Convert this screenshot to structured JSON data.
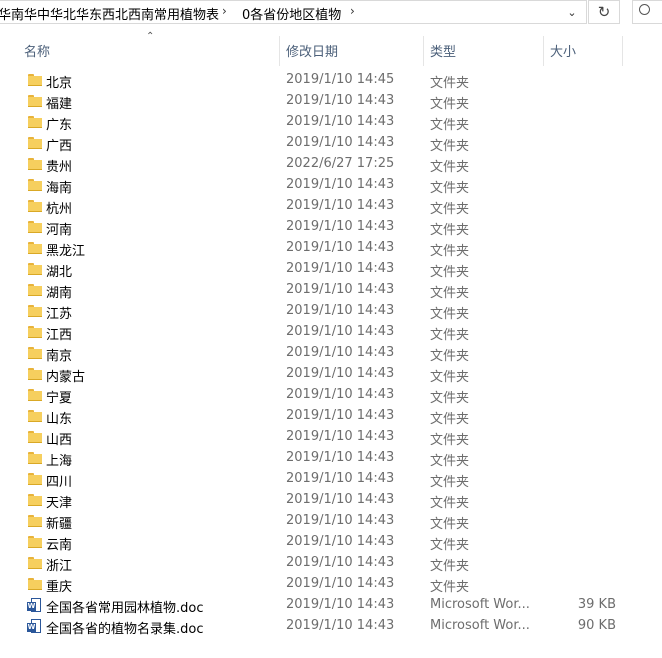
{
  "address": {
    "crumb1": "华南华中华北华东西北西南常用植物表",
    "crumb2": "0各省份地区植物",
    "separator": "›"
  },
  "columns": {
    "name": "名称",
    "date": "修改日期",
    "type": "类型",
    "size": "大小"
  },
  "files": [
    {
      "name": "北京",
      "date": "2019/1/10 14:45",
      "type": "文件夹",
      "size": "",
      "icon": "folder-icon"
    },
    {
      "name": "福建",
      "date": "2019/1/10 14:43",
      "type": "文件夹",
      "size": "",
      "icon": "folder-icon"
    },
    {
      "name": "广东",
      "date": "2019/1/10 14:43",
      "type": "文件夹",
      "size": "",
      "icon": "folder-icon"
    },
    {
      "name": "广西",
      "date": "2019/1/10 14:43",
      "type": "文件夹",
      "size": "",
      "icon": "folder-icon"
    },
    {
      "name": "贵州",
      "date": "2022/6/27 17:25",
      "type": "文件夹",
      "size": "",
      "icon": "folder-icon"
    },
    {
      "name": "海南",
      "date": "2019/1/10 14:43",
      "type": "文件夹",
      "size": "",
      "icon": "folder-icon"
    },
    {
      "name": "杭州",
      "date": "2019/1/10 14:43",
      "type": "文件夹",
      "size": "",
      "icon": "folder-icon"
    },
    {
      "name": "河南",
      "date": "2019/1/10 14:43",
      "type": "文件夹",
      "size": "",
      "icon": "folder-icon"
    },
    {
      "name": "黑龙江",
      "date": "2019/1/10 14:43",
      "type": "文件夹",
      "size": "",
      "icon": "folder-icon"
    },
    {
      "name": "湖北",
      "date": "2019/1/10 14:43",
      "type": "文件夹",
      "size": "",
      "icon": "folder-icon"
    },
    {
      "name": "湖南",
      "date": "2019/1/10 14:43",
      "type": "文件夹",
      "size": "",
      "icon": "folder-icon"
    },
    {
      "name": "江苏",
      "date": "2019/1/10 14:43",
      "type": "文件夹",
      "size": "",
      "icon": "folder-icon"
    },
    {
      "name": "江西",
      "date": "2019/1/10 14:43",
      "type": "文件夹",
      "size": "",
      "icon": "folder-icon"
    },
    {
      "name": "南京",
      "date": "2019/1/10 14:43",
      "type": "文件夹",
      "size": "",
      "icon": "folder-icon"
    },
    {
      "name": "内蒙古",
      "date": "2019/1/10 14:43",
      "type": "文件夹",
      "size": "",
      "icon": "folder-icon"
    },
    {
      "name": "宁夏",
      "date": "2019/1/10 14:43",
      "type": "文件夹",
      "size": "",
      "icon": "folder-icon"
    },
    {
      "name": "山东",
      "date": "2019/1/10 14:43",
      "type": "文件夹",
      "size": "",
      "icon": "folder-icon"
    },
    {
      "name": "山西",
      "date": "2019/1/10 14:43",
      "type": "文件夹",
      "size": "",
      "icon": "folder-icon"
    },
    {
      "name": "上海",
      "date": "2019/1/10 14:43",
      "type": "文件夹",
      "size": "",
      "icon": "folder-icon"
    },
    {
      "name": "四川",
      "date": "2019/1/10 14:43",
      "type": "文件夹",
      "size": "",
      "icon": "folder-icon"
    },
    {
      "name": "天津",
      "date": "2019/1/10 14:43",
      "type": "文件夹",
      "size": "",
      "icon": "folder-icon"
    },
    {
      "name": "新疆",
      "date": "2019/1/10 14:43",
      "type": "文件夹",
      "size": "",
      "icon": "folder-icon"
    },
    {
      "name": "云南",
      "date": "2019/1/10 14:43",
      "type": "文件夹",
      "size": "",
      "icon": "folder-icon"
    },
    {
      "name": "浙江",
      "date": "2019/1/10 14:43",
      "type": "文件夹",
      "size": "",
      "icon": "folder-icon"
    },
    {
      "name": "重庆",
      "date": "2019/1/10 14:43",
      "type": "文件夹",
      "size": "",
      "icon": "folder-icon"
    },
    {
      "name": "全国各省常用园林植物.doc",
      "date": "2019/1/10 14:43",
      "type": "Microsoft Wor...",
      "size": "39 KB",
      "icon": "word-doc-icon"
    },
    {
      "name": "全国各省的植物名录集.doc",
      "date": "2019/1/10 14:43",
      "type": "Microsoft Wor...",
      "size": "90 KB",
      "icon": "word-doc-icon"
    }
  ]
}
